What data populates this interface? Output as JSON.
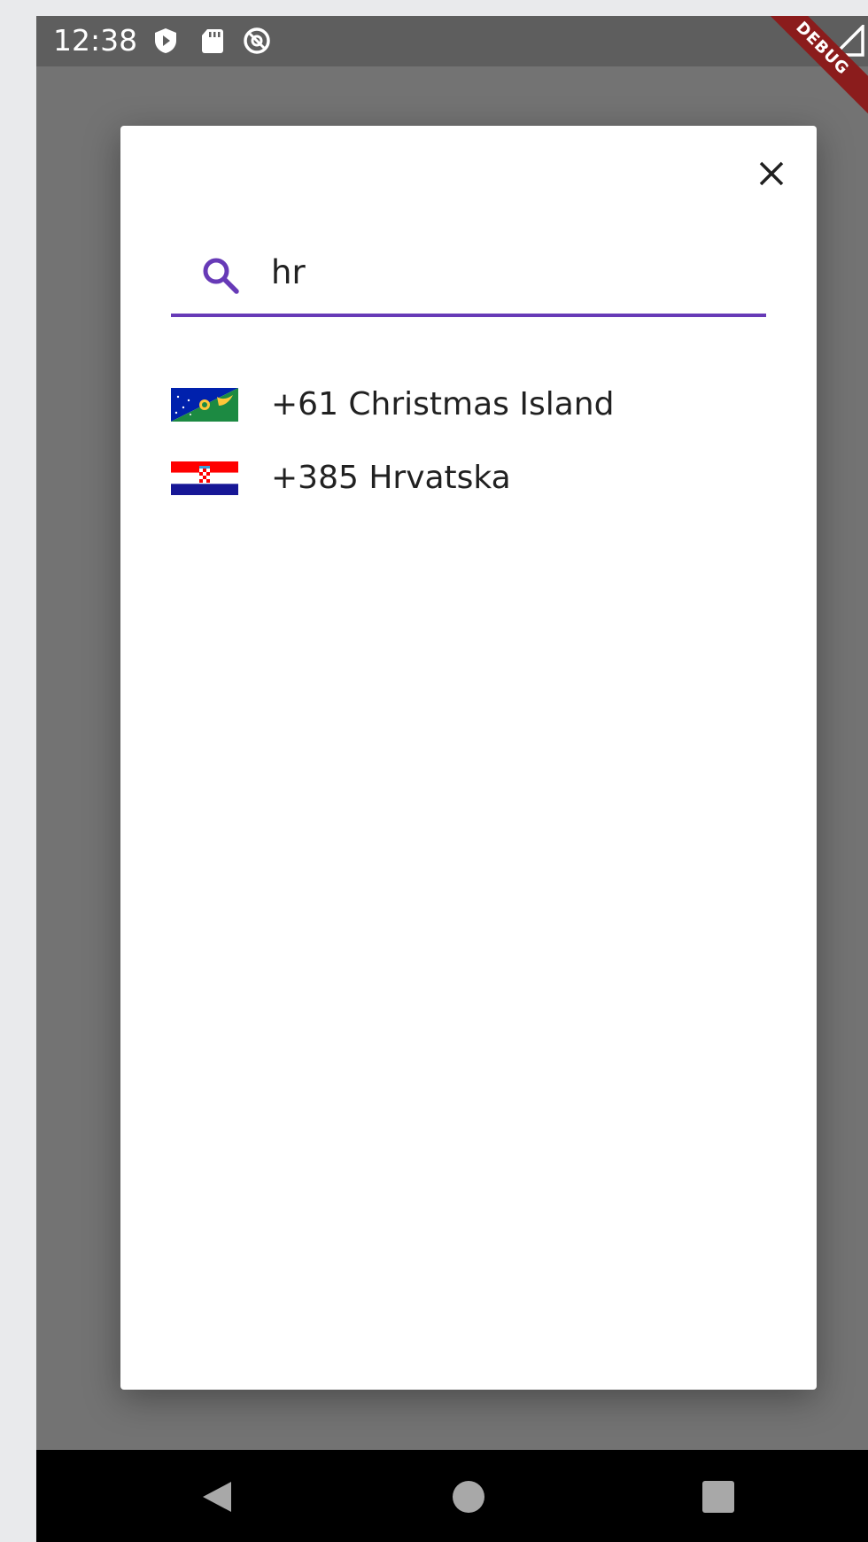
{
  "status_bar": {
    "time": "12:38",
    "icons": [
      "play-protect-icon",
      "sd-card-icon",
      "at-sign-icon"
    ],
    "right_icons": [
      "wifi-icon",
      "cellular-signal-icon"
    ],
    "debug_banner": "DEBUG"
  },
  "dialog": {
    "close_icon": "close-icon",
    "search": {
      "icon": "search-icon",
      "value": "hr",
      "accent_color": "#673ab7"
    },
    "results": [
      {
        "flag": "christmas-island-flag",
        "label": "+61 Christmas Island"
      },
      {
        "flag": "croatia-flag",
        "label": "+385 Hrvatska"
      }
    ]
  },
  "nav_bar": {
    "buttons": [
      "back-button",
      "home-button",
      "recents-button"
    ]
  }
}
